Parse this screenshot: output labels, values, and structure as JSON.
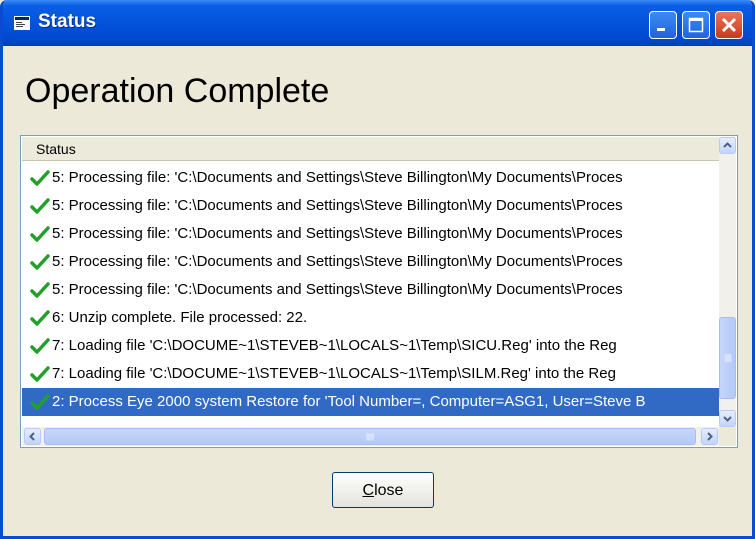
{
  "window": {
    "title": "Status"
  },
  "heading": "Operation Complete",
  "list": {
    "header": "Status",
    "rows": [
      {
        "text": "5: Processing file: 'C:\\Documents and Settings\\Steve Billington\\My Documents\\Proces",
        "selected": false
      },
      {
        "text": "5: Processing file: 'C:\\Documents and Settings\\Steve Billington\\My Documents\\Proces",
        "selected": false
      },
      {
        "text": "5: Processing file: 'C:\\Documents and Settings\\Steve Billington\\My Documents\\Proces",
        "selected": false
      },
      {
        "text": "5: Processing file: 'C:\\Documents and Settings\\Steve Billington\\My Documents\\Proces",
        "selected": false
      },
      {
        "text": "5: Processing file: 'C:\\Documents and Settings\\Steve Billington\\My Documents\\Proces",
        "selected": false
      },
      {
        "text": "6: Unzip complete. File processed: 22.",
        "selected": false
      },
      {
        "text": "7: Loading file 'C:\\DOCUME~1\\STEVEB~1\\LOCALS~1\\Temp\\SICU.Reg' into the Reg",
        "selected": false
      },
      {
        "text": "7: Loading file 'C:\\DOCUME~1\\STEVEB~1\\LOCALS~1\\Temp\\SILM.Reg' into the Reg",
        "selected": false
      },
      {
        "text": "2: Process Eye 2000 system Restore for 'Tool Number=, Computer=ASG1, User=Steve B",
        "selected": true
      }
    ],
    "row_icon": "green-check-icon"
  },
  "buttons": {
    "close_pre": "",
    "close_accel": "C",
    "close_post": "lose"
  },
  "colors": {
    "titlebar": "#0453DB",
    "selection": "#316AC5",
    "check": "#22A02A",
    "face": "#ECE9D8"
  }
}
